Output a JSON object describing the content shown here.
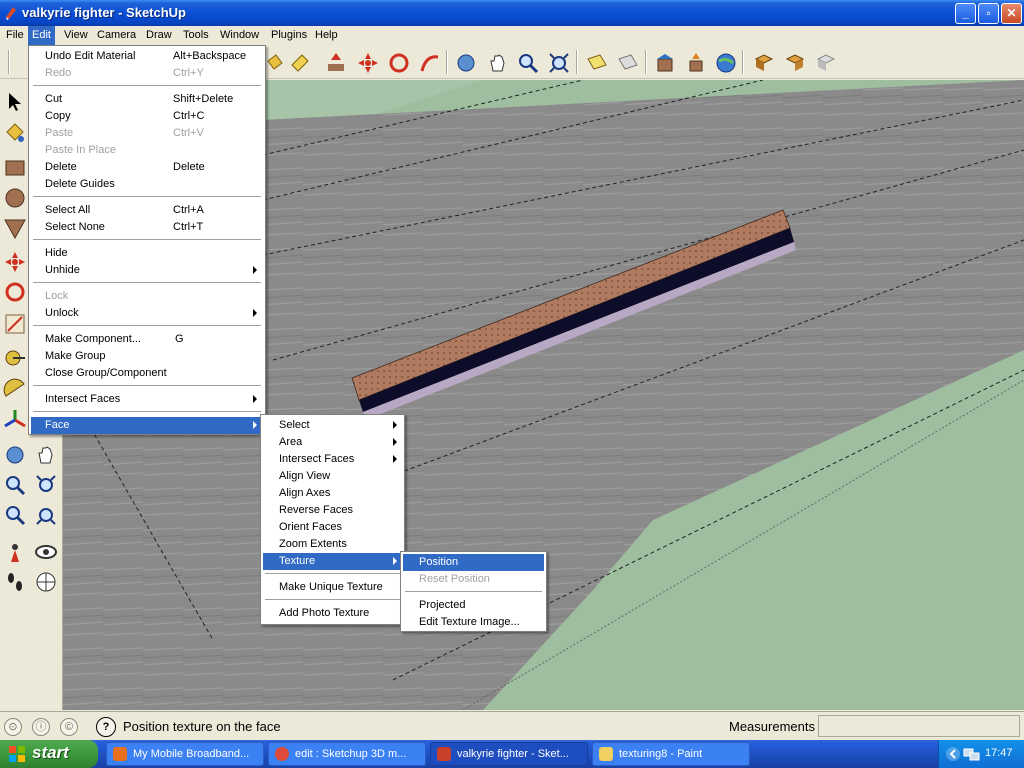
{
  "window": {
    "title": "valkyrie fighter - SketchUp",
    "min": "_",
    "max": "▫",
    "close": "✕"
  },
  "menubar": [
    {
      "label": "File"
    },
    {
      "label": "Edit"
    },
    {
      "label": "View"
    },
    {
      "label": "Camera"
    },
    {
      "label": "Draw"
    },
    {
      "label": "Tools"
    },
    {
      "label": "Window"
    },
    {
      "label": "Plugins"
    },
    {
      "label": "Help"
    }
  ],
  "edit_menu": {
    "items": [
      {
        "label": "Undo Edit Material",
        "shortcut": "Alt+Backspace"
      },
      {
        "label": "Redo",
        "shortcut": "Ctrl+Y",
        "disabled": true
      },
      {
        "label": "Cut",
        "shortcut": "Shift+Delete"
      },
      {
        "label": "Copy",
        "shortcut": "Ctrl+C"
      },
      {
        "label": "Paste",
        "shortcut": "Ctrl+V",
        "disabled": true
      },
      {
        "label": "Paste In Place",
        "shortcut": "",
        "disabled": true
      },
      {
        "label": "Delete",
        "shortcut": "Delete"
      },
      {
        "label": "Delete Guides",
        "shortcut": ""
      },
      {
        "label": "Select All",
        "shortcut": "Ctrl+A"
      },
      {
        "label": "Select None",
        "shortcut": "Ctrl+T"
      },
      {
        "label": "Hide",
        "shortcut": ""
      },
      {
        "label": "Unhide",
        "shortcut": ""
      },
      {
        "label": "Lock",
        "shortcut": "",
        "disabled": true
      },
      {
        "label": "Unlock",
        "shortcut": ""
      },
      {
        "label": "Make Component...",
        "shortcut": "G"
      },
      {
        "label": "Make Group",
        "shortcut": ""
      },
      {
        "label": "Close Group/Component",
        "shortcut": ""
      },
      {
        "label": "Intersect Faces",
        "shortcut": ""
      },
      {
        "label": "Face",
        "shortcut": ""
      }
    ]
  },
  "face_menu": {
    "items": [
      {
        "label": "Select"
      },
      {
        "label": "Area"
      },
      {
        "label": "Intersect Faces"
      },
      {
        "label": "Align View"
      },
      {
        "label": "Align Axes"
      },
      {
        "label": "Reverse Faces"
      },
      {
        "label": "Orient Faces"
      },
      {
        "label": "Zoom Extents"
      },
      {
        "label": "Texture"
      },
      {
        "label": "Make Unique Texture"
      },
      {
        "label": "Add Photo Texture"
      }
    ]
  },
  "texture_menu": {
    "items": [
      {
        "label": "Position"
      },
      {
        "label": "Reset Position",
        "disabled": true
      },
      {
        "label": "Projected"
      },
      {
        "label": "Edit Texture Image..."
      }
    ]
  },
  "statusbar": {
    "help_text": "Position texture on the face",
    "help_icon": "?",
    "measurements_label": "Measurements",
    "measurements_value": ""
  },
  "taskbar": {
    "start_label": "start",
    "tasks": [
      {
        "label": "My Mobile Broadband...",
        "icon": "firefox-icon"
      },
      {
        "label": "edit : Sketchup 3D m...",
        "icon": "chrome-icon"
      },
      {
        "label": "valkyrie fighter - Sket...",
        "icon": "sketchup-icon",
        "active": true
      },
      {
        "label": "texturing8 - Paint",
        "icon": "paint-icon"
      }
    ],
    "clock": "17:47"
  },
  "colors": {
    "menu_highlight": "#316ac5",
    "ground_green": "#9fbe9f",
    "surface_gray": "#8c8c8c",
    "strip_brown": "#b07a60",
    "strip_navy": "#0d0d2a",
    "strip_lavender": "#b8a8c4"
  }
}
